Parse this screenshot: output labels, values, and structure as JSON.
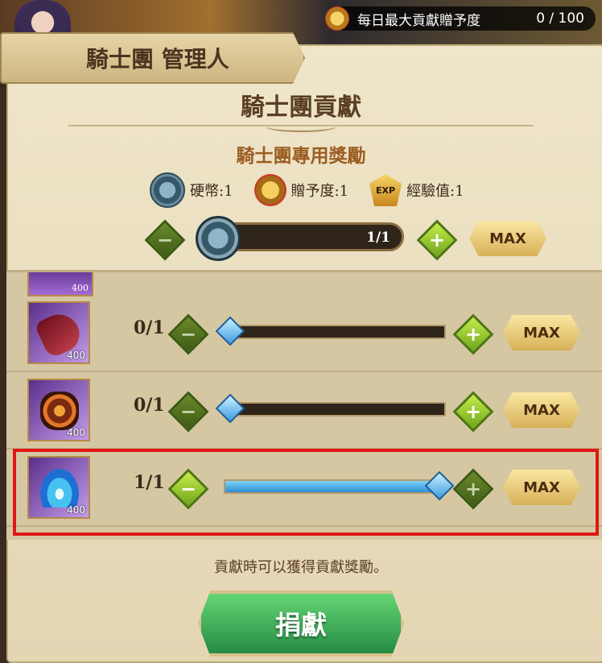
{
  "header": {
    "contribution_label": "每日最大貢獻贈予度",
    "contribution_value": "0 / 100"
  },
  "banner": {
    "title": "騎士團 管理人"
  },
  "panel": {
    "title": "騎士團貢獻",
    "subtitle": "騎士團專用獎勵",
    "rewards": [
      {
        "icon": "coin-icon",
        "label": "硬幣:1"
      },
      {
        "icon": "medal-icon",
        "label": "贈予度:1"
      },
      {
        "icon": "exp-icon",
        "label": "經驗值:1",
        "badge": "EXP"
      }
    ],
    "coin_slider": {
      "text": "1/1",
      "max_label": "MAX"
    }
  },
  "items": [
    {
      "icon": "crimson-tongue-icon",
      "qty": "400",
      "count": "0/1",
      "fill": 0.0,
      "max_label": "MAX"
    },
    {
      "icon": "magma-rock-icon",
      "qty": "400",
      "count": "0/1",
      "fill": 0.0,
      "max_label": "MAX"
    },
    {
      "icon": "blue-flame-icon",
      "qty": "400",
      "count": "1/1",
      "fill": 1.0,
      "max_label": "MAX"
    }
  ],
  "peek_item": {
    "qty": "400"
  },
  "hint": "貢獻時可以獲得貢獻獎勵。",
  "donate_button": "捐獻",
  "colors": {
    "highlight": "#e01515",
    "accent_green": "#258c44",
    "slider_blue": "#2e8fd6"
  }
}
